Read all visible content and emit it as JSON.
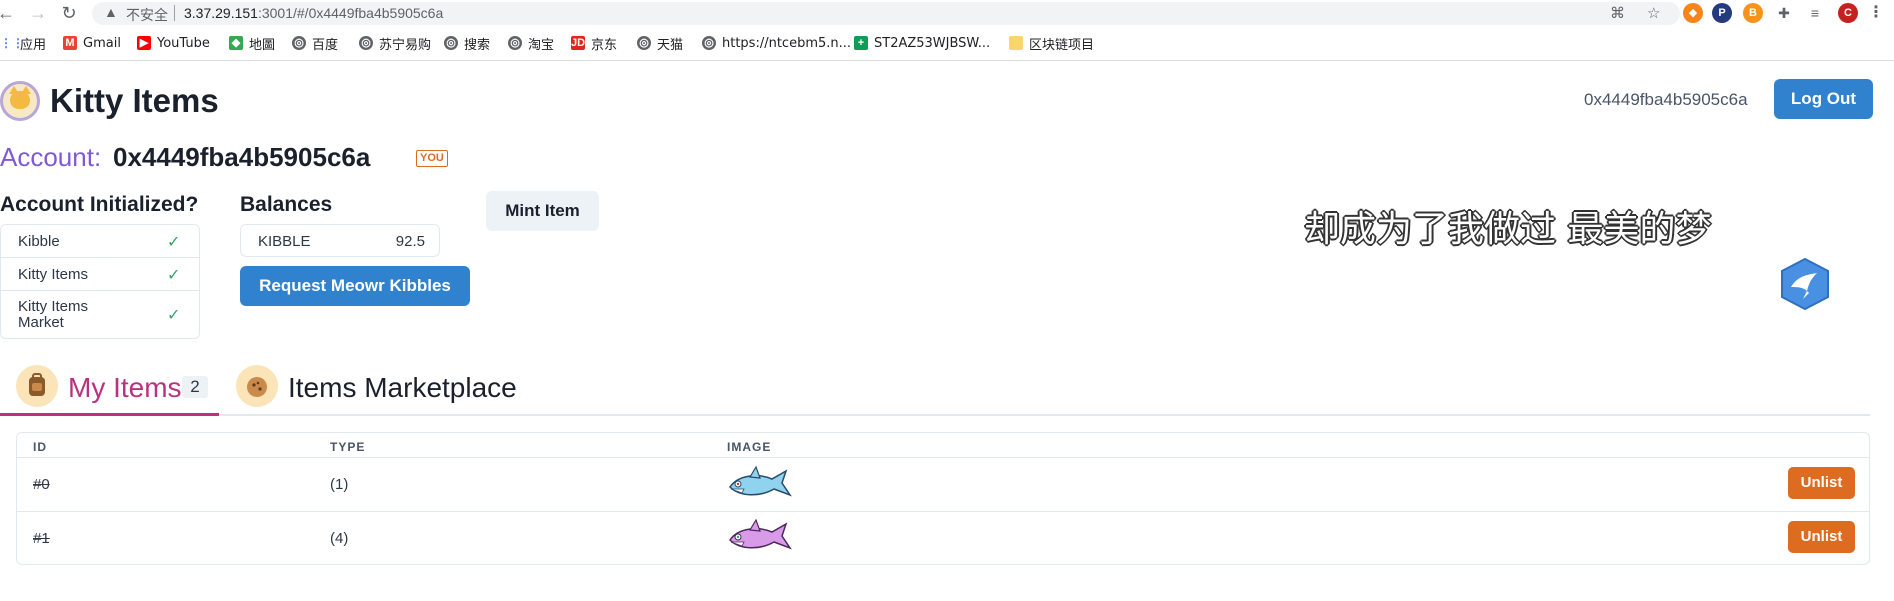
{
  "browser": {
    "insecure_label": "不安全",
    "url_host": "3.37.29.151",
    "url_rest": ":3001/#/0x4449fba4b5905c6a",
    "profile_initial": "C",
    "bookmarks": [
      {
        "label": "应用",
        "icon": "apps-grid-icon"
      },
      {
        "label": "Gmail",
        "icon": "gmail-icon"
      },
      {
        "label": "YouTube",
        "icon": "youtube-icon"
      },
      {
        "label": "地圖",
        "icon": "maps-icon"
      },
      {
        "label": "百度",
        "icon": "globe-icon"
      },
      {
        "label": "苏宁易购",
        "icon": "globe-icon"
      },
      {
        "label": "搜索",
        "icon": "globe-icon"
      },
      {
        "label": "淘宝",
        "icon": "globe-icon"
      },
      {
        "label": "京东",
        "icon": "jd-icon"
      },
      {
        "label": "天猫",
        "icon": "globe-icon"
      },
      {
        "label": "https://ntcebm5.n...",
        "icon": "globe-icon"
      },
      {
        "label": "ST2AZ53WJBSW...",
        "icon": "sheets-icon"
      },
      {
        "label": "区块链项目",
        "icon": "folder-icon"
      }
    ]
  },
  "header": {
    "title": "Kitty Items",
    "address": "0x4449fba4b5905c6a",
    "logout_label": "Log Out"
  },
  "account": {
    "label": "Account:",
    "address": "0x4449fba4b5905c6a",
    "badge": "YOU"
  },
  "initialized": {
    "heading": "Account Initialized?",
    "items": [
      {
        "label": "Kibble",
        "ok": true
      },
      {
        "label": "Kitty Items",
        "ok": true
      },
      {
        "label": "Kitty Items Market",
        "ok": true
      }
    ]
  },
  "balances": {
    "heading": "Balances",
    "token": "KIBBLE",
    "value": "92.5",
    "request_label": "Request Meowr Kibbles"
  },
  "mint_label": "Mint Item",
  "overlay_text": "却成为了我做过 最美的梦",
  "tabs": [
    {
      "label": "My Items",
      "count": "2",
      "active": true
    },
    {
      "label": "Items Marketplace",
      "active": false
    }
  ],
  "table": {
    "headers": [
      "ID",
      "TYPE",
      "IMAGE"
    ],
    "rows": [
      {
        "id": "#0",
        "type": "(1)",
        "image": "blue-shark-icon",
        "action": "Unlist"
      },
      {
        "id": "#1",
        "type": "(4)",
        "image": "pink-shark-icon",
        "action": "Unlist"
      }
    ]
  },
  "colors": {
    "accent_blue": "#3182ce",
    "accent_purple": "#805ad5",
    "accent_orange": "#dd6b20",
    "tab_active": "#b83280",
    "check_green": "#38a169"
  }
}
